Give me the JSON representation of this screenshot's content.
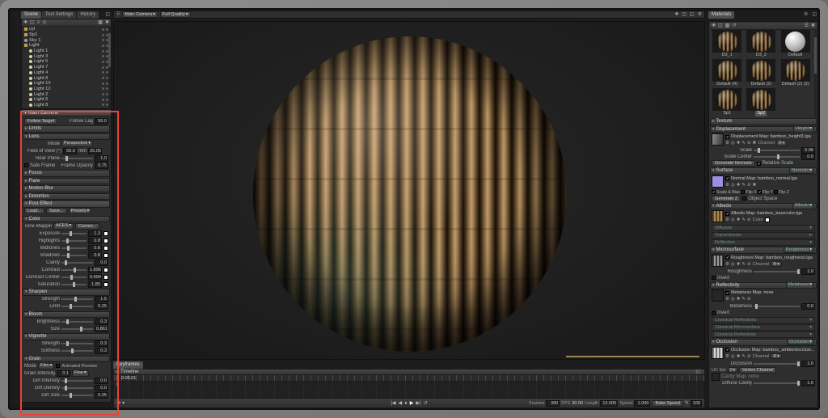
{
  "icons": {
    "tri_down": "▾",
    "tri_right": "▸",
    "check": "✓",
    "dots": "⠿",
    "external": "◱",
    "gear": "⚙",
    "picker": "◎",
    "add": "✚",
    "edit": "✎",
    "clear": "⊘",
    "delete": "✖",
    "folder": "▩",
    "menu": "☰",
    "list": "≡",
    "duplicate": "◫",
    "search": "◎",
    "loop": "↺",
    "play": "▶",
    "play_back": "◀",
    "skip_start": "|◀",
    "skip_end": "▶|",
    "record": "●",
    "pencil": "✎"
  },
  "left": {
    "tabs": [
      {
        "label": "Scene",
        "cls": "active"
      },
      {
        "label": "Tool Settings",
        "cls": ""
      },
      {
        "label": "History",
        "cls": ""
      }
    ],
    "tree": [
      {
        "cls": "folder",
        "ind": "",
        "label": "cyl"
      },
      {
        "cls": "folder",
        "ind": "",
        "label": "Sp1"
      },
      {
        "cls": "sky",
        "ind": "",
        "label": "Sky 1"
      },
      {
        "cls": "folder",
        "ind": "",
        "label": "Light"
      },
      {
        "cls": "light",
        "ind": "indent",
        "label": "Light 1"
      },
      {
        "cls": "light",
        "ind": "indent",
        "label": "Light 3"
      },
      {
        "cls": "light",
        "ind": "indent",
        "label": "Light 5"
      },
      {
        "cls": "light",
        "ind": "indent",
        "label": "Light 7"
      },
      {
        "cls": "light",
        "ind": "indent",
        "label": "Light 4"
      },
      {
        "cls": "light",
        "ind": "indent",
        "label": "Light 8"
      },
      {
        "cls": "light",
        "ind": "indent",
        "label": "Light 10"
      },
      {
        "cls": "light",
        "ind": "indent",
        "label": "Light 12"
      },
      {
        "cls": "light",
        "ind": "indent",
        "label": "Light 2"
      },
      {
        "cls": "light",
        "ind": "indent",
        "label": "Light 6"
      },
      {
        "cls": "light",
        "ind": "indent",
        "label": "Light 8"
      }
    ],
    "camera_header": "Main Camera",
    "cam": {
      "follow_target": "Follow Target",
      "follow_lag_label": "Follow Lag",
      "follow_lag": "56.0",
      "sec_limits": "Limits",
      "sec_lens": "Lens",
      "mode_label": "Mode",
      "mode": "Perspective",
      "fov_label": "Field of View (°)",
      "fov": "55.0",
      "mm_label": "mm",
      "mm": "25.05",
      "near_label": "Near Plane",
      "near": "1.0",
      "safe_frame": "Safe Frame",
      "frame_opacity_label": "Frame Opacity",
      "frame_opacity": "0.75",
      "collapsed": [
        {
          "label": "Focus"
        },
        {
          "label": "Flare"
        },
        {
          "label": "Motion Blur"
        },
        {
          "label": "Distortion"
        }
      ],
      "sec_post": "Post Effect",
      "load": "Load...",
      "save": "Save...",
      "presets": "Presets",
      "sec_color": "Color",
      "tone_label": "Tone Mapping",
      "tone": "ACES",
      "curves": "Curves...",
      "color_sliders": [
        {
          "label": "Exposure",
          "value": "1.3",
          "sw": "on",
          "pct": "32%"
        },
        {
          "label": "Highlights",
          "value": "0.8",
          "sw": "on",
          "pct": "20%"
        },
        {
          "label": "Midtones",
          "value": "0.8",
          "sw": "on",
          "pct": "22%"
        },
        {
          "label": "Shadows",
          "value": "0.8",
          "sw": "on",
          "pct": "22%"
        },
        {
          "label": "Clarity",
          "value": "0.0",
          "sw": "off",
          "pct": "10%"
        },
        {
          "label": "Contrast",
          "value": "1.896",
          "sw": "on",
          "pct": "48%"
        },
        {
          "label": "Contrast Center",
          "value": "0.694",
          "sw": "on",
          "pct": "36%"
        },
        {
          "label": "Saturation",
          "value": "1.85",
          "sw": "on",
          "pct": "46%"
        }
      ],
      "sec_sharpen": "Sharpen",
      "sharpen": [
        {
          "label": "Strength",
          "value": "1.5",
          "sw": "off",
          "pct": "40%"
        },
        {
          "label": "Limit",
          "value": "0.25",
          "sw": "off",
          "pct": "26%"
        }
      ],
      "sec_bloom": "Bloom",
      "bloom": [
        {
          "label": "Brightness",
          "value": "0.3",
          "sw": "off",
          "pct": "15%"
        },
        {
          "label": "Size",
          "value": "0.861",
          "sw": "off",
          "pct": "58%"
        }
      ],
      "sec_vignette": "Vignette",
      "vignette": [
        {
          "label": "Strength",
          "value": "0.3",
          "sw": "off",
          "pct": "15%"
        },
        {
          "label": "Softness",
          "value": "0.3",
          "sw": "off",
          "pct": "30%"
        }
      ],
      "sec_grain": "Grain",
      "grain_mode_label": "Mode",
      "grain_mode": "Film",
      "animated_preview": "Animated Preview",
      "grain_int_label": "Grain Intensity",
      "grain_int": "0.1",
      "grain_type": "Fine",
      "grain_sliders": [
        {
          "label": "Dirt Intensity",
          "value": "0.0",
          "sw": "off",
          "pct": "10%"
        },
        {
          "label": "Dirt Density",
          "value": "0.0",
          "sw": "off",
          "pct": "10%"
        },
        {
          "label": "Dirt Size",
          "value": "0.25",
          "sw": "off",
          "pct": "26%"
        }
      ]
    }
  },
  "viewport": {
    "camera": "Main Camera",
    "quality": "Full Quality"
  },
  "timeline": {
    "tab": "Keyframes",
    "header": "Timeline",
    "time": "0:00.01",
    "track": "1",
    "frames_label": "Frames",
    "frames": "390",
    "fps_label": "FPS",
    "fps": "30.00",
    "length_label": "Length",
    "length": "13.000",
    "speed_label": "Speed",
    "speed": "1.000",
    "bake": "Bake Speed",
    "zoom": "100"
  },
  "materials": {
    "tab": "Materials",
    "thumbs": [
      {
        "label": "D3_1",
        "ball": "bamboo",
        "sel": ""
      },
      {
        "label": "D3_2",
        "ball": "bamboo",
        "sel": ""
      },
      {
        "label": "Default",
        "ball": "white",
        "sel": ""
      },
      {
        "label": "Default (4)",
        "ball": "bamboo",
        "sel": ""
      },
      {
        "label": "Default (2)",
        "ball": "bamboo",
        "sel": ""
      },
      {
        "label": "Default (2) (2)",
        "ball": "bamboo",
        "sel": ""
      },
      {
        "label": "Sp1",
        "ball": "bamboo",
        "sel": ""
      },
      {
        "label": "Sp2",
        "ball": "bamboo",
        "sel": "sel"
      }
    ],
    "sec_texture": "Texture",
    "disp": {
      "header": "Displacement",
      "dd": "Height",
      "map": "Displacement Map: bamboo_height3.tga",
      "channel_label": "Channel",
      "channel": "R",
      "scale_label": "Scale",
      "scale": "0.06",
      "center_label": "Scale Center",
      "center": "0.5",
      "gen_normals": "Generate Normals",
      "rel_scale": "Relative Scale"
    },
    "surface": {
      "header": "Surface",
      "dd": "Normals",
      "map": "Normal Map: bamboo_normal.tga",
      "checks": [
        {
          "label": "Scale & Bias",
          "chk": "on"
        },
        {
          "label": "Flip X",
          "chk": "off"
        },
        {
          "label": "Flip Y",
          "chk": "on"
        },
        {
          "label": "Flip Z",
          "chk": "off"
        }
      ],
      "gen_z": "Generate Z",
      "object_space": "Object Space"
    },
    "albedo": {
      "header": "Albedo",
      "dd": "Albedo",
      "map": "Albedo Map: bamboo_basecolor.tga",
      "color_label": "Color"
    },
    "sec_diffusion": "Diffusion",
    "sec_transmission": "Transmission",
    "sec_reflection": "Reflection",
    "micro": {
      "header": "Microsurface",
      "dd": "Roughness",
      "map": "Roughness Map: bamboo_roughness.tga",
      "channel_label": "Channel",
      "channel": "R",
      "rough_label": "Roughness",
      "rough": "1.0",
      "invert": "Invert"
    },
    "refl": {
      "header": "Reflectivity",
      "dd": "Metalness",
      "map": "Metalness Map: none",
      "metal_label": "Metalness",
      "metal": "0.0",
      "invert": "Invert",
      "classical": [
        {
          "label": "Classical Reflections"
        },
        {
          "label": "Classical Microsurface"
        },
        {
          "label": "Classical Reflectivity"
        }
      ]
    },
    "occ": {
      "header": "Occlusion",
      "dd": "Occlusion",
      "map": "Occlusion Map: bamboo_ambientocclusi...",
      "channel_label": "Channel",
      "channel": "R",
      "occ_label": "Occlusion",
      "occ": "1.0",
      "uv_label": "UV Set",
      "uv": "0",
      "vertex": "Vertex Channel",
      "cavity_map": "Cavity Map: none",
      "cavity_label": "Diffuse Cavity",
      "cavity": "1.0"
    }
  }
}
